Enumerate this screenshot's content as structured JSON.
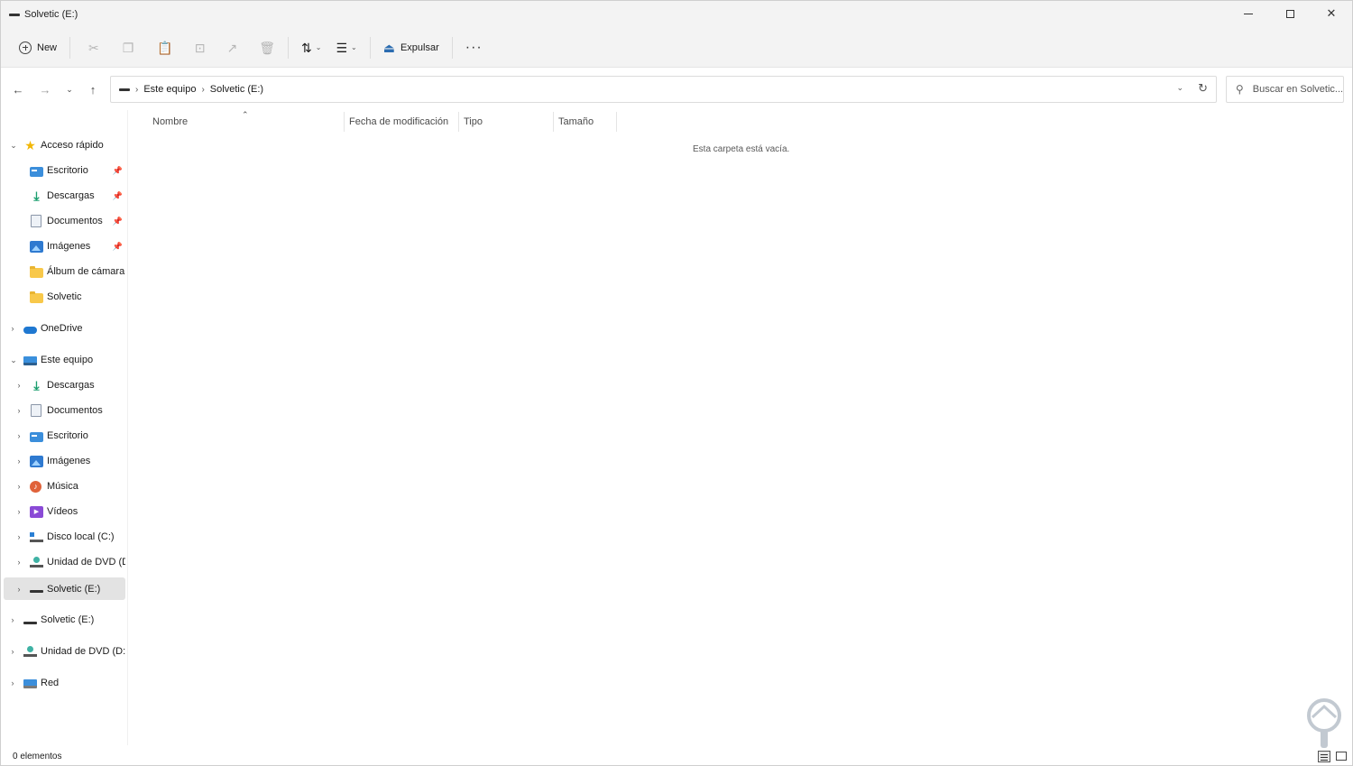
{
  "window": {
    "title": "Solvetic (E:)",
    "controls": {
      "minimize": "minimize",
      "maximize": "maximize",
      "close": "✕"
    }
  },
  "toolbar": {
    "new_label": "New",
    "eject_label": "Expulsar",
    "icons": [
      "cut-icon",
      "copy-icon",
      "paste-icon",
      "rename-icon",
      "share-icon",
      "delete-icon",
      "sort-icon",
      "view-icon",
      "eject-icon",
      "more-icon"
    ]
  },
  "address": {
    "crumbs": [
      "Este equipo",
      "Solvetic (E:)"
    ],
    "search_placeholder": "Buscar en Solvetic..."
  },
  "sidebar": {
    "items": [
      {
        "label": "Acceso rápido",
        "icon": "star-icon"
      },
      {
        "label": "Escritorio",
        "icon": "desktop-icon",
        "pinned": true
      },
      {
        "label": "Descargas",
        "icon": "download-icon",
        "pinned": true
      },
      {
        "label": "Documentos",
        "icon": "documents-icon",
        "pinned": true
      },
      {
        "label": "Imágenes",
        "icon": "pictures-icon",
        "pinned": true
      },
      {
        "label": "Álbum de cámara",
        "icon": "folder-icon"
      },
      {
        "label": "Solvetic",
        "icon": "folder-icon"
      },
      {
        "label": "OneDrive",
        "icon": "onedrive-icon"
      },
      {
        "label": "Este equipo",
        "icon": "pc-icon"
      },
      {
        "label": "Descargas",
        "icon": "download-icon"
      },
      {
        "label": "Documentos",
        "icon": "documents-icon"
      },
      {
        "label": "Escritorio",
        "icon": "desktop-icon"
      },
      {
        "label": "Imágenes",
        "icon": "pictures-icon"
      },
      {
        "label": "Música",
        "icon": "music-icon"
      },
      {
        "label": "Vídeos",
        "icon": "videos-icon"
      },
      {
        "label": "Disco local (C:)",
        "icon": "local-disk-icon"
      },
      {
        "label": "Unidad de DVD (D:",
        "icon": "dvd-drive-icon"
      },
      {
        "label": "Solvetic (E:)",
        "icon": "usb-drive-icon",
        "selected": true
      },
      {
        "label": "Solvetic (E:)",
        "icon": "usb-drive-icon"
      },
      {
        "label": "Unidad de DVD (D:) (",
        "icon": "dvd-drive-icon"
      },
      {
        "label": "Red",
        "icon": "network-icon"
      }
    ]
  },
  "content": {
    "columns": [
      "Nombre",
      "Fecha de modificación",
      "Tipo",
      "Tamaño"
    ],
    "sorted_column": "Nombre",
    "empty_message": "Esta carpeta está vacía."
  },
  "status": {
    "item_count": "0 elementos"
  },
  "colors": {
    "chrome_bg": "#f3f3f3",
    "selected_bg": "#e3e3e3",
    "accent": "#2b6cb0"
  }
}
